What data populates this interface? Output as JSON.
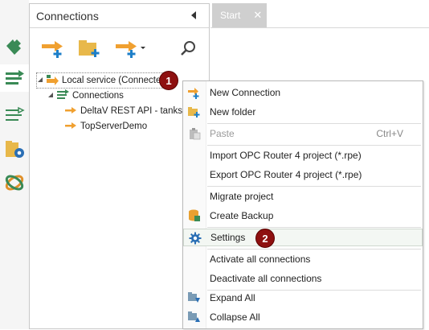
{
  "panel": {
    "title": "Connections"
  },
  "tabs": [
    {
      "label": "Start",
      "close": "✕"
    }
  ],
  "tree": {
    "root": "Local service (Connected)",
    "group": "Connections",
    "items": [
      "DeltaV REST API - tanks",
      "TopServerDemo"
    ]
  },
  "callouts": {
    "first": "1",
    "second": "2"
  },
  "context_menu": {
    "items": [
      {
        "label": "New Connection",
        "icon": "add-connection-icon"
      },
      {
        "label": "New folder",
        "icon": "add-folder-icon"
      },
      {
        "label": "Paste",
        "shortcut": "Ctrl+V",
        "icon": "clipboard-icon",
        "disabled": true
      },
      {
        "label": "Import OPC Router 4 project (*.rpe)"
      },
      {
        "label": "Export OPC Router 4 project (*.rpe)"
      },
      {
        "label": "Migrate project"
      },
      {
        "label": "Create Backup",
        "icon": "database-icon"
      },
      {
        "label": "Settings",
        "icon": "gear-icon"
      },
      {
        "label": "Activate all connections"
      },
      {
        "label": "Deactivate all connections"
      },
      {
        "label": "Expand All",
        "icon": "expand-all-icon"
      },
      {
        "label": "Collapse All",
        "icon": "collapse-all-icon"
      }
    ]
  },
  "colors": {
    "accent_orange": "#f0a030",
    "plus_blue": "#1e7fc8",
    "callout_red": "#8e1010",
    "icon_green": "#3a8a56"
  }
}
